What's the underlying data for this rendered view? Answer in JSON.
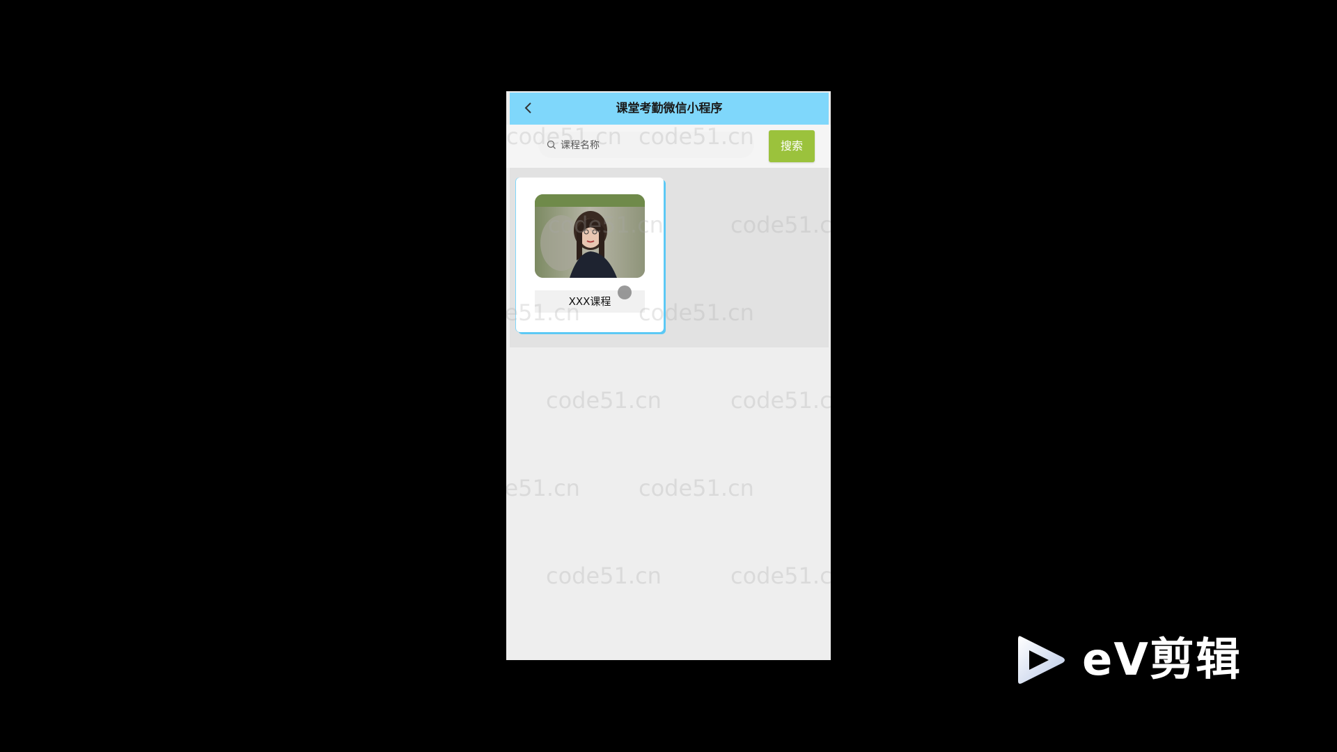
{
  "app": {
    "title": "课堂考勤微信小程序"
  },
  "search": {
    "placeholder": "课程名称",
    "button_label": "搜索"
  },
  "courses": [
    {
      "name": "XXX课程",
      "image": "portrait-photo"
    }
  ],
  "watermark": {
    "text": "code51.cn"
  },
  "overlay": {
    "logo_text": "eV剪辑"
  },
  "colors": {
    "navbar": "#7fd7fb",
    "search_button": "#9bc23c",
    "card_border": "#5cc9f5"
  }
}
